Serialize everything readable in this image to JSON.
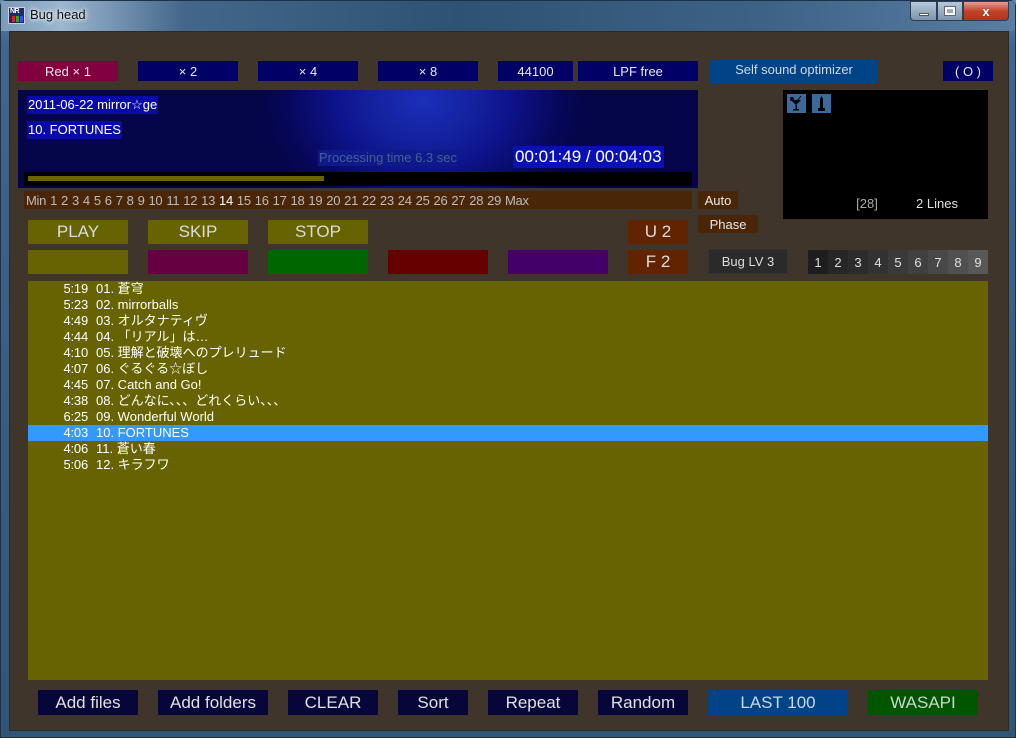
{
  "window": {
    "title": "Bug head",
    "controls": {
      "minimize": "minimize",
      "maximize": "maximize",
      "close": "x"
    }
  },
  "top_bar": {
    "buttons": [
      {
        "label": "Red × 1",
        "color": "#800040"
      },
      {
        "label": "× 2",
        "color": "#000066"
      },
      {
        "label": "× 4",
        "color": "#000066"
      },
      {
        "label": "× 8",
        "color": "#000066"
      },
      {
        "label": "44100",
        "color": "#000066"
      },
      {
        "label": "LPF free",
        "color": "#000066"
      },
      {
        "label": "Self sound optimizer",
        "color": "#004488"
      },
      {
        "label": "( O )",
        "color": "#000066"
      }
    ]
  },
  "now_playing": {
    "album": "2011-06-22 mirror☆ge",
    "track": "10. FORTUNES",
    "processing_label": "Processing time  6.3 sec",
    "time": "00:01:49 / 00:04:03",
    "progress_fraction": 0.449
  },
  "levels": {
    "items": [
      "Min",
      "1",
      "2",
      "3",
      "4",
      "5",
      "6",
      "7",
      "8",
      "9",
      "10",
      "11",
      "12",
      "13",
      "14",
      "15",
      "16",
      "17",
      "18",
      "19",
      "20",
      "21",
      "22",
      "23",
      "24",
      "25",
      "26",
      "27",
      "28",
      "29",
      "Max"
    ],
    "active": "14",
    "auto_label": "Auto",
    "phase_label": "Phase"
  },
  "transport": {
    "play": "PLAY",
    "skip": "SKIP",
    "stop": "STOP",
    "u2": "U 2",
    "f2": "F 2",
    "color_swatches": [
      "#666300",
      "#660040",
      "#006600",
      "#660000",
      "#440066"
    ]
  },
  "side_panel": {
    "icons": [
      "cocktail-icon",
      "tower-icon"
    ],
    "bracket_value": "[28]",
    "lines_label": "2 Lines"
  },
  "bug_level": {
    "label": "Bug LV 3",
    "numbers": [
      "1",
      "2",
      "3",
      "4",
      "5",
      "6",
      "7",
      "8",
      "9"
    ]
  },
  "playlist": {
    "selected_index": 9,
    "tracks": [
      {
        "duration": "5:19",
        "title": "01. 蒼穹"
      },
      {
        "duration": "5:23",
        "title": "02. mirrorballs"
      },
      {
        "duration": "4:49",
        "title": "03. オルタナティヴ"
      },
      {
        "duration": "4:44",
        "title": "04. 「リアル」は…"
      },
      {
        "duration": "4:10",
        "title": "05. 理解と破壊へのプレリュード"
      },
      {
        "duration": "4:07",
        "title": "06. ぐるぐる☆ぼし"
      },
      {
        "duration": "4:45",
        "title": "07. Catch and Go!"
      },
      {
        "duration": "4:38",
        "title": "08. どんなに、、、どれくらい、、、"
      },
      {
        "duration": "6:25",
        "title": "09. Wonderful World"
      },
      {
        "duration": "4:03",
        "title": "10. FORTUNES"
      },
      {
        "duration": "4:06",
        "title": "11. 蒼い春"
      },
      {
        "duration": "5:06",
        "title": "12. キラフワ"
      }
    ]
  },
  "bottom_bar": {
    "add_files": "Add files",
    "add_folders": "Add folders",
    "clear": "CLEAR",
    "sort": "Sort",
    "repeat": "Repeat",
    "random": "Random",
    "last100": "LAST 100",
    "wasapi": "WASAPI"
  }
}
